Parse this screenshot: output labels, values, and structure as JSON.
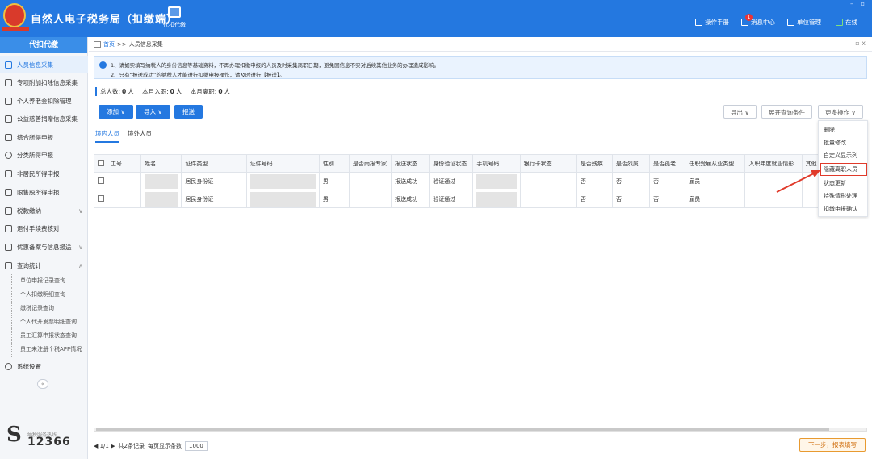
{
  "header": {
    "app_title": "自然人电子税务局（扣缴端）",
    "module_label": "代扣代缴",
    "links": [
      {
        "label": "操作手册"
      },
      {
        "label": "消息中心",
        "badge": "1"
      },
      {
        "label": "单位管理"
      },
      {
        "label": "在线"
      }
    ],
    "window_controls": "– ▫"
  },
  "sidebar": {
    "title": "代扣代缴",
    "items": [
      {
        "label": "人员信息采集"
      },
      {
        "label": "专项附加扣除信息采集"
      },
      {
        "label": "个人养老金扣除管理"
      },
      {
        "label": "公益慈善捐赠信息采集"
      },
      {
        "label": "综合所得申报"
      },
      {
        "label": "分类所得申报"
      },
      {
        "label": "非居民所得申报"
      },
      {
        "label": "限售股所得申报"
      },
      {
        "label": "税款缴纳",
        "chevron": "∨"
      },
      {
        "label": "退付手续费核对"
      },
      {
        "label": "优惠备案与信息报送",
        "chevron": "∨"
      },
      {
        "label": "查询统计",
        "chevron": "∧"
      }
    ],
    "sub_items": [
      {
        "label": "单位申报记录查询"
      },
      {
        "label": "个人扣缴明细查询"
      },
      {
        "label": "缴税记录查询"
      },
      {
        "label": "个人代开发票明细查询"
      },
      {
        "label": "员工汇算申报状态查询"
      },
      {
        "label": "员工未注册个税APP情况"
      }
    ],
    "settings_label": "系统设置",
    "collapse": "«",
    "hotline_label": "纳税服务热线",
    "hotline_number": "12366"
  },
  "breadcrumb": {
    "home": "首页",
    "separator": ">>",
    "current": "人员信息采集",
    "close": "▫ x"
  },
  "notice": {
    "line1": "1、请如实填写纳税人的身份信息等基础资料，不再办理扣缴申报的人员及时采集离职日期，避免因信息不实对后续其他业务的办理造成影响。",
    "line2": "2、只有“报送成功”的纳税人才能进行扣缴申报操作，请及时进行【报送】。"
  },
  "stats": {
    "total_label": "总人数:",
    "total_value": "0",
    "total_unit": "人",
    "new_label": "本月入职:",
    "new_value": "0",
    "new_unit": "人",
    "left_label": "本月离职:",
    "left_value": "0",
    "left_unit": "人"
  },
  "toolbar": {
    "add": "添加 ∨",
    "import": "导入 ∨",
    "submit": "报送",
    "export": "导出 ∨",
    "expand_query": "展开查询条件",
    "more_ops": "更多操作 ∨"
  },
  "tabs": [
    {
      "label": "境内人员",
      "active": true
    },
    {
      "label": "境外人员",
      "active": false
    }
  ],
  "table": {
    "columns": [
      "",
      "工号",
      "姓名",
      "证件类型",
      "证件号码",
      "性别",
      "是否雨报专家",
      "报送状态",
      "身份验证状态",
      "手机号码",
      "银行卡状态",
      "是否残疾",
      "是否烈属",
      "是否孤老",
      "任职受雇从业类型",
      "入职年度就业情形",
      "其他"
    ],
    "rows": [
      [
        "",
        "",
        "",
        "居民身份证",
        "",
        "男",
        "",
        "报送成功",
        "验证通过",
        "",
        "",
        "否",
        "否",
        "否",
        "雇员",
        "",
        ""
      ],
      [
        "",
        "",
        "",
        "居民身份证",
        "",
        "男",
        "",
        "报送成功",
        "验证通过",
        "",
        "",
        "否",
        "否",
        "否",
        "雇员",
        "",
        ""
      ]
    ]
  },
  "more_menu": {
    "items": [
      "删除",
      "批量修改",
      "自定义显示列",
      "隐藏离职人员",
      "状态更新",
      "特殊情形处理",
      "扣缴申报确认"
    ],
    "highlighted_index": 3,
    "highlight_color": "#e03a2a"
  },
  "pager": {
    "nav": "◀ 1/1 ▶",
    "total": "共2条记录",
    "per_page_label": "每页显示条数",
    "per_page_value": "1000"
  },
  "next_button": "下一步，报表填写",
  "colors": {
    "header_blue": "#2478e0",
    "accent_orange": "#e89a30"
  }
}
